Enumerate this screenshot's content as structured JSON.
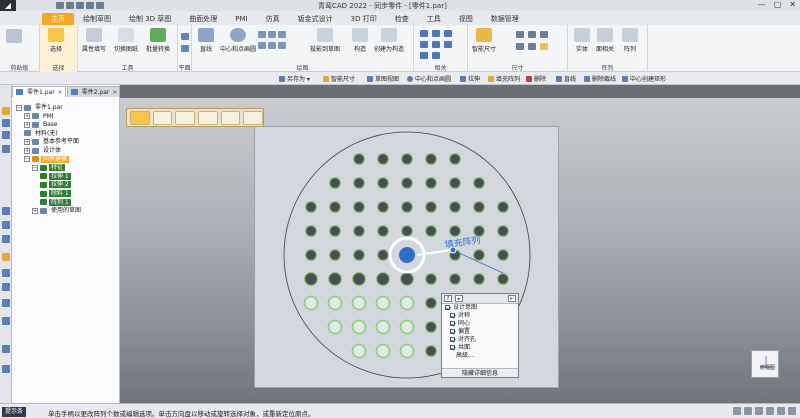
{
  "app": {
    "title": "青鸾CAD 2022 - 同步零件 - [零件1.par]",
    "logo_glyph": "◢",
    "window_controls": [
      "—",
      "▢",
      "✕"
    ]
  },
  "ribbon_tabs": [
    "主页",
    "绘制草图",
    "绘制 3D 草图",
    "曲面处理",
    "PMI",
    "仿真",
    "钣金式设计",
    "3D 打印",
    "检查",
    "工具",
    "视图",
    "数据管理"
  ],
  "ribbon": {
    "buttons": {
      "select": "选择",
      "attr_fill": "属性填写",
      "switch_sheet": "切换图纸",
      "batch_convert": "批量转换",
      "line": "直线",
      "center_point": "中心和点画圆",
      "project_sketch": "投影到草图",
      "construct": "构造",
      "create_construct": "创建为构造",
      "smart_dim": "智能尺寸",
      "solid": "实体",
      "face_relation": "面相关",
      "pattern": "阵列"
    },
    "groups": {
      "clipboard": "剪贴板",
      "select": "选择",
      "tools": "工具",
      "plane": "平面",
      "draw": "绘图",
      "relate": "相关",
      "dimension": "尺寸",
      "pattern": "阵列"
    }
  },
  "command_bar": [
    "另存为 ▾",
    "智能尺寸",
    "草图视图",
    "中心和点画圆",
    "拉伸",
    "填充阵列",
    "删除",
    "直线",
    "删除截线",
    "中心创建矩形"
  ],
  "doc_tabs": [
    {
      "label": "零件1.par",
      "active": true
    },
    {
      "label": "零件2.par",
      "active": false
    }
  ],
  "tree": [
    {
      "label": "零件1.par",
      "level": 0,
      "toggle": "−",
      "style": "plain"
    },
    {
      "label": "PMI",
      "level": 1,
      "toggle": "+",
      "style": "plain"
    },
    {
      "label": "Base",
      "level": 1,
      "toggle": "+",
      "style": "plain"
    },
    {
      "label": "材料(无)",
      "level": 1,
      "toggle": "",
      "style": "plain"
    },
    {
      "label": "基本参考平面",
      "level": 1,
      "toggle": "+",
      "style": "plain"
    },
    {
      "label": "设计体",
      "level": 1,
      "toggle": "+",
      "style": "plain"
    },
    {
      "label": "同步建模",
      "level": 1,
      "toggle": "−",
      "style": "sel"
    },
    {
      "label": "特征",
      "level": 2,
      "toggle": "−",
      "style": "green"
    },
    {
      "label": "拉伸 1",
      "level": 3,
      "toggle": "",
      "style": "green"
    },
    {
      "label": "拉伸 2",
      "level": 3,
      "toggle": "",
      "style": "green"
    },
    {
      "label": "除料 1",
      "level": 3,
      "toggle": "",
      "style": "green"
    },
    {
      "label": "阵列 1",
      "level": 3,
      "toggle": "",
      "style": "green"
    },
    {
      "label": "使用的草图",
      "level": 2,
      "toggle": "+",
      "style": "plain"
    }
  ],
  "canvas": {
    "pattern_label": "填充阵列"
  },
  "relation_panel": {
    "header_icons": [
      "?",
      "▸",
      "⇤"
    ],
    "items": [
      "设计意图",
      "对称",
      "同心",
      "偏置",
      "对齐孔",
      "共面",
      "高级..."
    ],
    "footer": "隐藏详细信息"
  },
  "orientation_label": "俯视图",
  "status": {
    "tag": "提示条",
    "text": "单击手柄以更改阵列个数或编辑选项。单击方向盘以移动或旋转选择对象，或重新定位原点。"
  },
  "colors": {
    "accent": "#f5a623",
    "hole_green": "#8dd07a",
    "handle_blue": "#2f6fc4"
  }
}
